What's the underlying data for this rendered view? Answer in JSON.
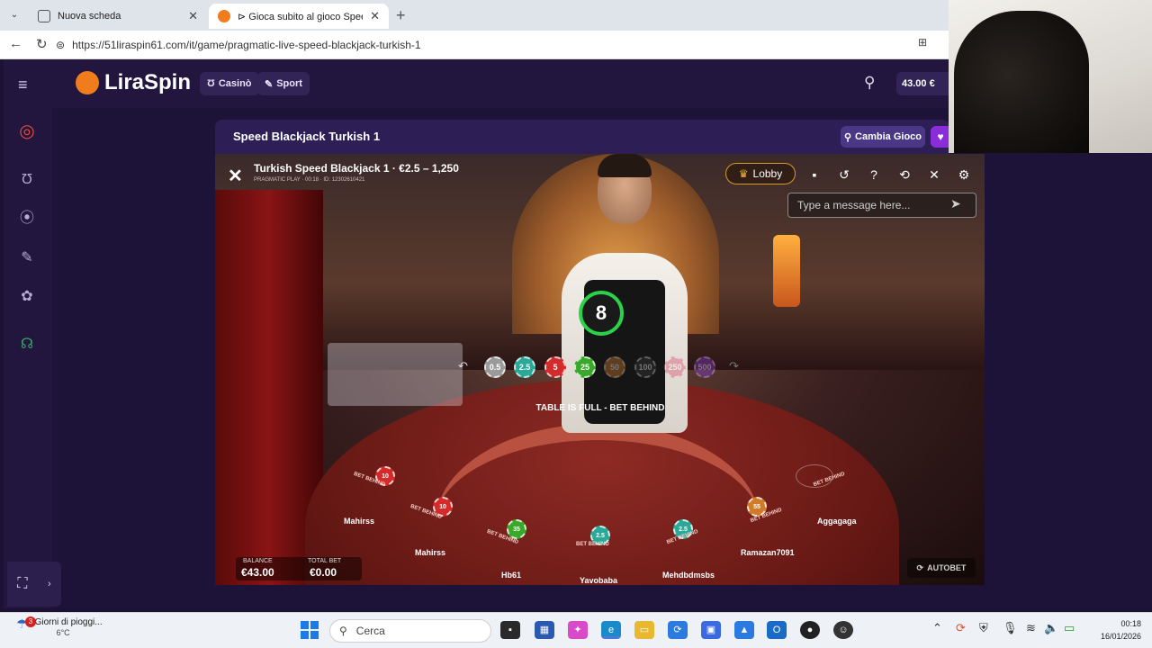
{
  "browser": {
    "tabs": [
      {
        "label": "Nuova scheda"
      },
      {
        "label": "⊳ Gioca subito al gioco Speed Bla"
      }
    ],
    "url": "https://51liraspin61.com/it/game/pragmatic-live-speed-blackjack-turkish-1"
  },
  "site": {
    "brand": "LiraSpin",
    "nav": {
      "casino": "Casinò",
      "sport": "Sport"
    },
    "balance": "43.00 €"
  },
  "game": {
    "page_title": "Speed Blackjack Turkish 1",
    "change_game": "Cambia Gioco",
    "table_name": "Turkish Speed Blackjack 1 · €2.5 – 1,250",
    "meta": "PRAGMATIC PLAY · 00:18 · ID: 12302610421",
    "lobby": "Lobby",
    "chat_placeholder": "Type a message here...",
    "timer": "8",
    "chips": [
      {
        "value": "0.5",
        "color": "#9a9a9a"
      },
      {
        "value": "2.5",
        "color": "#2aa898"
      },
      {
        "value": "5",
        "color": "#d42a2a"
      },
      {
        "value": "25",
        "color": "#3aa82a"
      },
      {
        "value": "50",
        "color": "#d07a2a"
      },
      {
        "value": "100",
        "color": "#3a3a3a"
      },
      {
        "value": "250",
        "color": "#d84a6a"
      },
      {
        "value": "500",
        "color": "#8a3ad8"
      }
    ],
    "table_full": "TABLE IS FULL - BET BEHIND",
    "bet_behind": "BET BEHIND",
    "seats": [
      {
        "name": "Mahirss",
        "chip": "10",
        "chip_color": "#d42a2a"
      },
      {
        "name": "Mahirss",
        "chip": "10",
        "chip_color": "#d42a2a"
      },
      {
        "name": "Hb61",
        "chip": "35",
        "chip_color": "#3aa82a"
      },
      {
        "name": "Yavobaba",
        "chip": "2.5",
        "chip_color": "#2aa898"
      },
      {
        "name": "Mehdbdmsbs",
        "chip": "2.5",
        "chip_color": "#2aa898"
      },
      {
        "name": "Ramazan7091",
        "chip": "55",
        "chip_color": "#d07a2a"
      },
      {
        "name": "Aggagaga",
        "chip": "",
        "chip_color": ""
      }
    ],
    "balance_label": "BALANCE",
    "balance_value": "€43.00",
    "total_bet_label": "TOTAL BET",
    "total_bet_value": "€0.00",
    "autobet": "AUTOBET"
  },
  "taskbar": {
    "weather_text": "Giorni di pioggi...",
    "temperature": "6°C",
    "weather_badge": "3",
    "search": "Cerca",
    "time": "00:18",
    "date": "16/01/2026"
  }
}
